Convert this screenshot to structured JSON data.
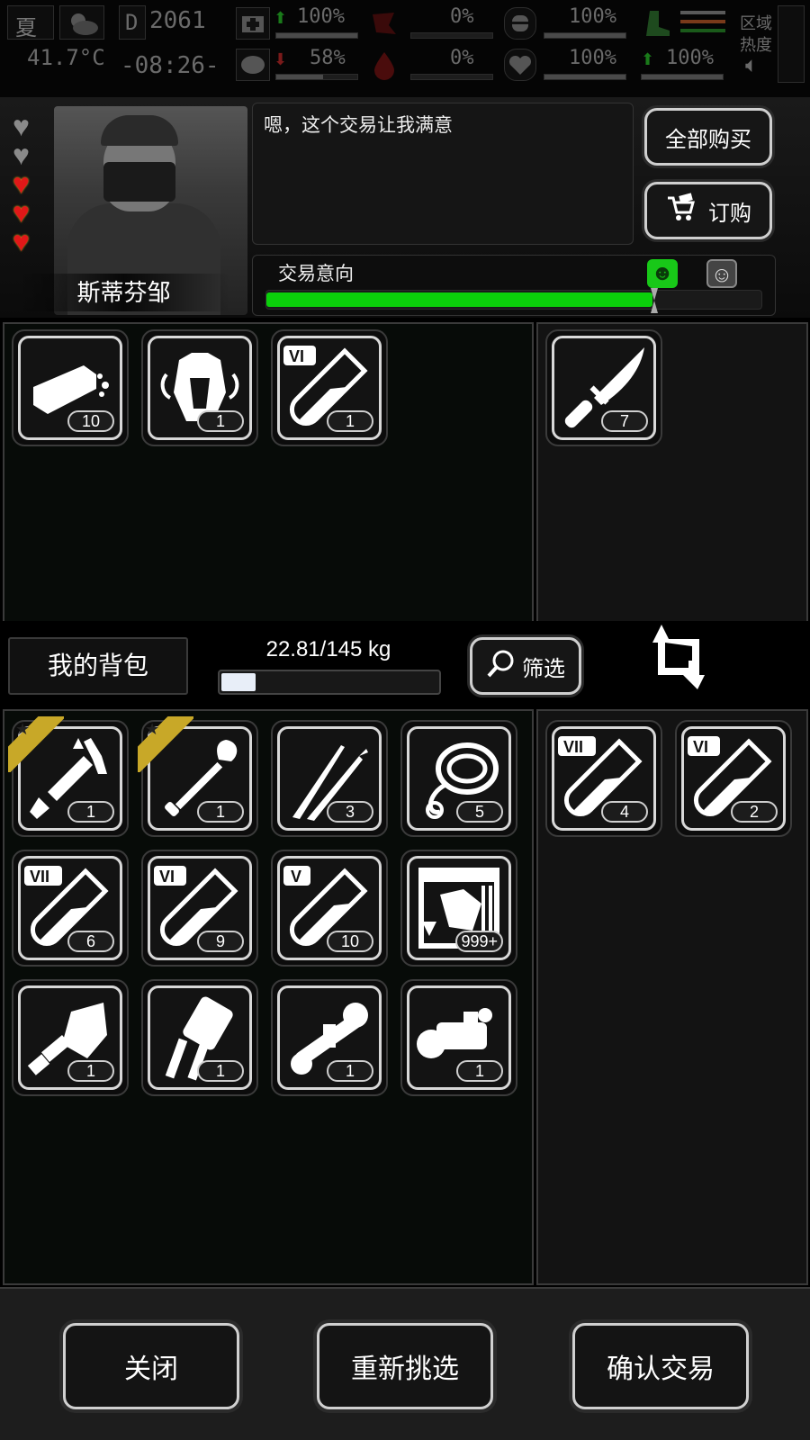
{
  "status_bar": {
    "season": "夏",
    "temperature": "41.7°C",
    "day_number": "2061",
    "time": "-08:26-",
    "health_pct": "100%",
    "hunger_pct": "58%",
    "bleeding_pct": "0%",
    "thirst_pct": "0%",
    "stomach_pct": "100%",
    "mood_pct": "100%",
    "stamina_pct": "100%",
    "zone_heat_label_1": "区域",
    "zone_heat_label_2": "热度",
    "icons": [
      "medkit-icon",
      "brain-icon",
      "blood-drop-icon",
      "stomach-icon",
      "heart-icon",
      "boot-icon",
      "sound-icon",
      "weather-sun-cloud-icon"
    ],
    "health_level": 1.0,
    "hunger_level": 0.58,
    "stomach_level": 1.0,
    "mood_level": 1.0,
    "stamina_level": 1.0
  },
  "merchant": {
    "name": "斯蒂芬邹",
    "dialog": "嗯，这个交易让我满意",
    "hearts": {
      "total": 5,
      "filled": 3,
      "colors": {
        "filled": "#e01818",
        "empty": "#8a8a8a"
      }
    },
    "buy_all_label": "全部购买",
    "order_label": "订购",
    "intent_label": "交易意向",
    "intent_level": 0.78,
    "intent_color": "#0bd00b",
    "inventory": [
      {
        "icon": "bread-icon",
        "count": "10"
      },
      {
        "icon": "tactical-vest-icon",
        "count": "1"
      },
      {
        "icon": "test-tube-icon",
        "tier": "VI",
        "count": "1"
      }
    ],
    "offer": [
      {
        "icon": "knife-icon",
        "count": "7"
      }
    ]
  },
  "bag": {
    "title": "我的背包",
    "weight": "22.81/145 kg",
    "weight_level": 0.157,
    "filter_label": "筛选",
    "items": [
      {
        "icon": "multitool-icon",
        "count": "1",
        "starred": true
      },
      {
        "icon": "shovel-icon",
        "count": "1",
        "starred": true
      },
      {
        "icon": "tweezers-icon",
        "count": "3",
        "starred": false
      },
      {
        "icon": "rope-icon",
        "count": "5",
        "starred": false
      },
      {
        "icon": "test-tube-icon",
        "tier": "VII",
        "count": "6",
        "starred": false
      },
      {
        "icon": "test-tube-icon",
        "tier": "VI",
        "count": "9",
        "starred": false
      },
      {
        "icon": "test-tube-icon",
        "tier": "V",
        "count": "10",
        "starred": false
      },
      {
        "icon": "zombie-card-icon",
        "count": "999+",
        "starred": false
      },
      {
        "icon": "folding-shovel-icon",
        "count": "1",
        "starred": false
      },
      {
        "icon": "bipod-grip-icon",
        "count": "1",
        "starred": false
      },
      {
        "icon": "rifle-scope-icon",
        "count": "1",
        "starred": false
      },
      {
        "icon": "red-dot-sight-icon",
        "count": "1",
        "starred": false
      }
    ],
    "offer": [
      {
        "icon": "test-tube-icon",
        "tier": "VII",
        "count": "4"
      },
      {
        "icon": "test-tube-icon",
        "tier": "VI",
        "count": "2"
      }
    ]
  },
  "footer": {
    "close_label": "关闭",
    "reselect_label": "重新挑选",
    "confirm_label": "确认交易"
  },
  "colors": {
    "badge_gold": "#c8a828",
    "slot_border": "#d8d8d8"
  }
}
